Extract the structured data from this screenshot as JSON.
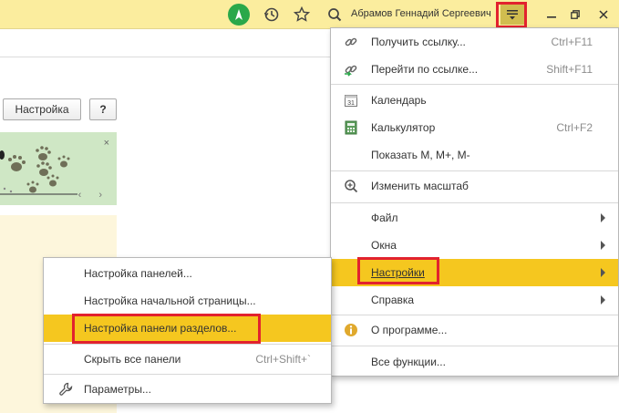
{
  "titlebar": {
    "username": "Абрамов Геннадий Сергеевич",
    "icons": [
      "start-logo-icon",
      "history-icon",
      "favorites-star-icon",
      "search-icon",
      "main-menu-icon",
      "minimize-icon",
      "restore-icon",
      "close-icon"
    ]
  },
  "page": {
    "settings_button": "Настройка",
    "help_button": "?",
    "banner_close": "×",
    "banner_nav": "‹ ›"
  },
  "main_menu": {
    "items": [
      {
        "label": "Получить ссылку...",
        "shortcut": "Ctrl+F11",
        "icon": "link-icon"
      },
      {
        "label": "Перейти по ссылке...",
        "shortcut": "Shift+F11",
        "icon": "goto-link-icon"
      },
      {
        "label": "Календарь",
        "shortcut": "",
        "icon": "calendar-icon",
        "icon_text": "31"
      },
      {
        "label": "Калькулятор",
        "shortcut": "Ctrl+F2",
        "icon": "calculator-icon"
      },
      {
        "label": "Показать М, М+, М-",
        "shortcut": "",
        "icon": ""
      },
      {
        "label": "Изменить масштаб",
        "shortcut": "",
        "icon": "zoom-icon"
      },
      {
        "label": "Файл",
        "shortcut": "",
        "icon": "",
        "submenu": true
      },
      {
        "label": "Окна",
        "shortcut": "",
        "icon": "",
        "submenu": true
      },
      {
        "label": "Настройки",
        "shortcut": "",
        "icon": "",
        "submenu": true,
        "active": true
      },
      {
        "label": "Справка",
        "shortcut": "",
        "icon": "",
        "submenu": true
      },
      {
        "label": "О программе...",
        "shortcut": "",
        "icon": "info-icon"
      },
      {
        "label": "Все функции...",
        "shortcut": "",
        "icon": ""
      }
    ]
  },
  "settings_submenu": {
    "items": [
      {
        "label": "Настройка панелей...",
        "shortcut": "",
        "icon": ""
      },
      {
        "label": "Настройка начальной страницы...",
        "shortcut": "",
        "icon": ""
      },
      {
        "label": "Настройка панели разделов...",
        "shortcut": "",
        "icon": "",
        "active": true
      },
      {
        "label": "Скрыть все панели",
        "shortcut": "Ctrl+Shift+`",
        "icon": ""
      },
      {
        "label": "Параметры...",
        "shortcut": "",
        "icon": "wrench-icon"
      }
    ]
  },
  "colors": {
    "titlebar_bg": "#fbed9e",
    "menu_highlight": "#f5c71f",
    "annotation_red": "#e2222e",
    "logo_green": "#2aa84a"
  }
}
